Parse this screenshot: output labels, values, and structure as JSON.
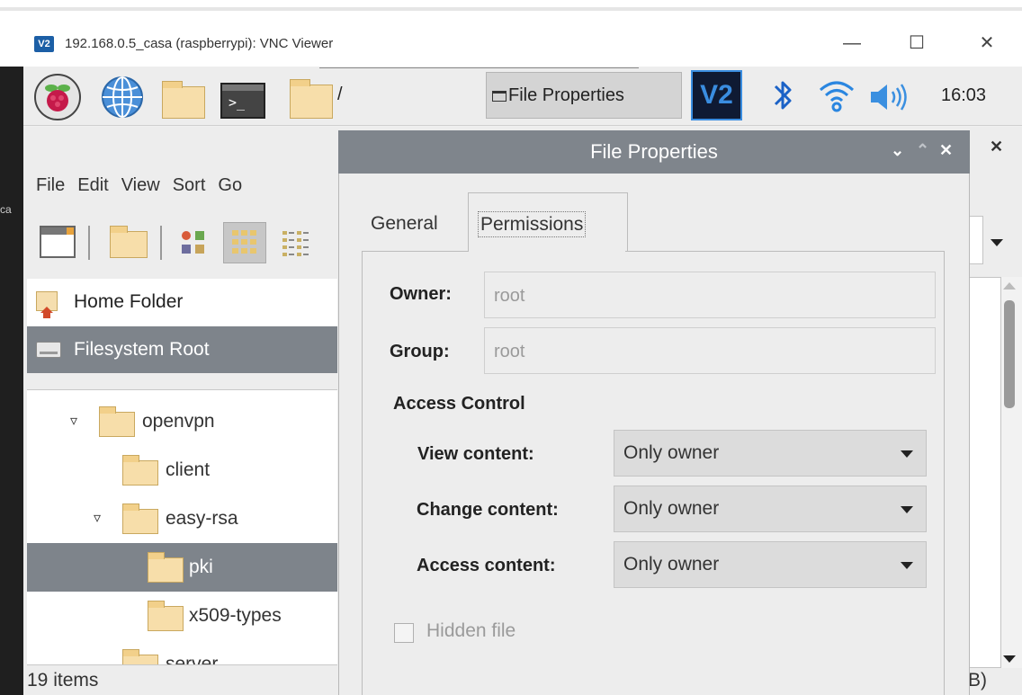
{
  "vnc_window": {
    "title": "192.168.0.5_casa (raspberrypi): VNC Viewer",
    "logo_text": "V2",
    "minimize": "—",
    "maximize": "☐",
    "close": "✕"
  },
  "taskbar": {
    "path_label": "/",
    "task_button": "File Properties",
    "vnc_icon_text": "V2",
    "clock": "16:03"
  },
  "file_manager": {
    "menu": [
      "File",
      "Edit",
      "View",
      "Sort",
      "Go"
    ],
    "close_glyph": "✕",
    "sidebar": [
      {
        "label": "Home Folder",
        "icon": "home-icon",
        "selected": false
      },
      {
        "label": "Filesystem Root",
        "icon": "drive-icon",
        "selected": true
      }
    ],
    "tree": [
      {
        "label": "openvpn",
        "indent": 1,
        "expander": "▿",
        "selected": false
      },
      {
        "label": "client",
        "indent": 2,
        "expander": "",
        "selected": false
      },
      {
        "label": "easy-rsa",
        "indent": 2,
        "expander": "▿",
        "selected": false
      },
      {
        "label": "pki",
        "indent": 3,
        "expander": "",
        "selected": true
      },
      {
        "label": "x509-types",
        "indent": 3,
        "expander": "",
        "selected": false
      },
      {
        "label": "server",
        "indent": 2,
        "expander": "",
        "selected": false
      }
    ],
    "status": "19 items",
    "status_right": "B)",
    "side_label": "ca"
  },
  "dialog": {
    "title": "File Properties",
    "buttons": {
      "minimize": "⌄",
      "maximize": "⌃",
      "close": "✕"
    },
    "tabs": [
      {
        "label": "General",
        "active": false
      },
      {
        "label": "Permissions",
        "active": true
      }
    ],
    "owner_label": "Owner:",
    "owner_value": "root",
    "group_label": "Group:",
    "group_value": "root",
    "access_header": "Access Control",
    "view_label": "View content:",
    "view_value": "Only owner",
    "change_label": "Change content:",
    "change_value": "Only owner",
    "access_label": "Access content:",
    "access_value": "Only owner",
    "hidden_label": "Hidden file",
    "hidden_checked": false
  }
}
